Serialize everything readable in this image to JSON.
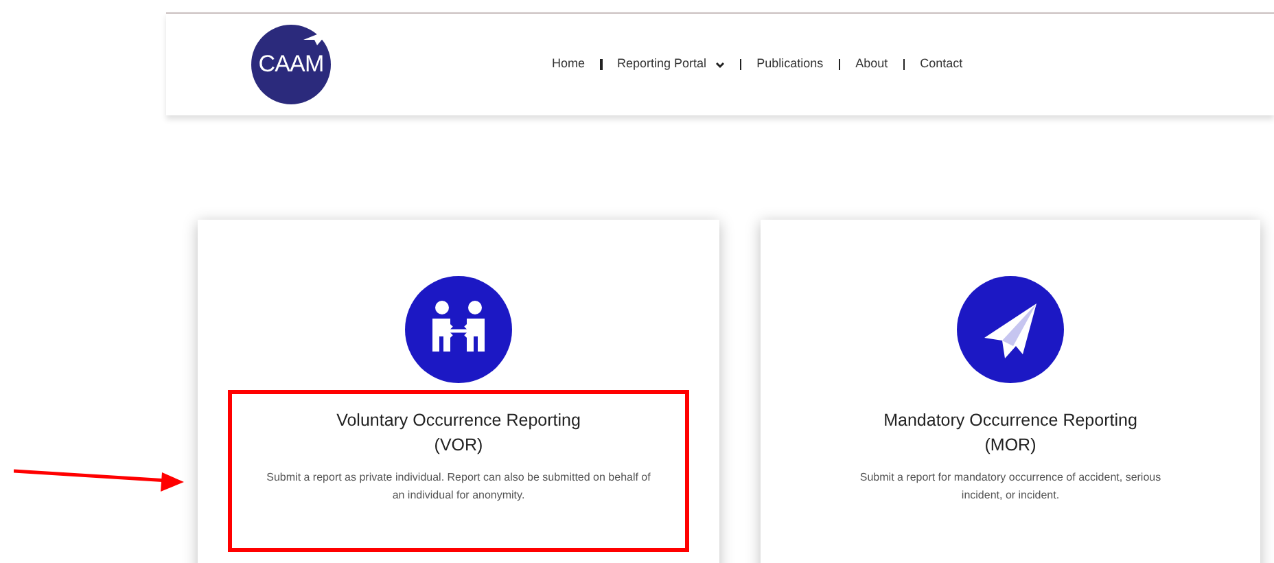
{
  "header": {
    "logo": {
      "text": "CAAM"
    },
    "nav": [
      {
        "label": "Home",
        "dropdown": false
      },
      {
        "label": "Reporting Portal",
        "dropdown": true
      },
      {
        "label": "Publications",
        "dropdown": false
      },
      {
        "label": "About",
        "dropdown": false
      },
      {
        "label": "Contact",
        "dropdown": false
      }
    ]
  },
  "cards": [
    {
      "kind": "people",
      "title": "Voluntary Occurrence Reporting",
      "abbr": "(VOR)",
      "description": "Submit a report as private individual. Report can also be submitted on behalf of an individual for anonymity.",
      "highlighted": true
    },
    {
      "kind": "plane",
      "title": "Mandatory Occurrence Reporting",
      "abbr": "(MOR)",
      "description": "Submit a report for mandatory occurrence of accident, serious incident, or incident.",
      "highlighted": false
    }
  ],
  "annotation": {
    "arrow": true
  }
}
